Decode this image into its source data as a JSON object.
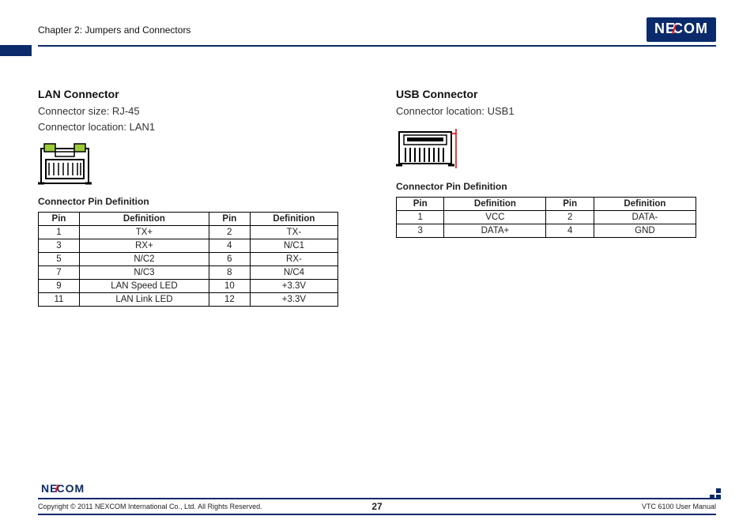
{
  "header": {
    "chapter": "Chapter 2: Jumpers and Connectors",
    "logo_text_1": "NE",
    "logo_text_2": "COM"
  },
  "lan": {
    "title": "LAN Connector",
    "size": "Connector size: RJ-45",
    "location": "Connector location: LAN1",
    "def_heading": "Connector Pin Definition",
    "th_pin": "Pin",
    "th_def": "Definition",
    "rows": [
      {
        "p1": "1",
        "d1": "TX+",
        "p2": "2",
        "d2": "TX-"
      },
      {
        "p1": "3",
        "d1": "RX+",
        "p2": "4",
        "d2": "N/C1"
      },
      {
        "p1": "5",
        "d1": "N/C2",
        "p2": "6",
        "d2": "RX-"
      },
      {
        "p1": "7",
        "d1": "N/C3",
        "p2": "8",
        "d2": "N/C4"
      },
      {
        "p1": "9",
        "d1": "LAN Speed LED",
        "p2": "10",
        "d2": "+3.3V"
      },
      {
        "p1": "11",
        "d1": "LAN Link LED",
        "p2": "12",
        "d2": "+3.3V"
      }
    ]
  },
  "usb": {
    "title": "USB Connector",
    "location": "Connector location: USB1",
    "def_heading": "Connector Pin Definition",
    "th_pin": "Pin",
    "th_def": "Definition",
    "rows": [
      {
        "p1": "1",
        "d1": "VCC",
        "p2": "2",
        "d2": "DATA-"
      },
      {
        "p1": "3",
        "d1": "DATA+",
        "p2": "4",
        "d2": "GND"
      }
    ]
  },
  "footer": {
    "logo1": "NE",
    "logo2": "COM",
    "copyright": "Copyright © 2011 NEXCOM International Co., Ltd. All Rights Reserved.",
    "page": "27",
    "manual": "VTC 6100 User Manual"
  }
}
